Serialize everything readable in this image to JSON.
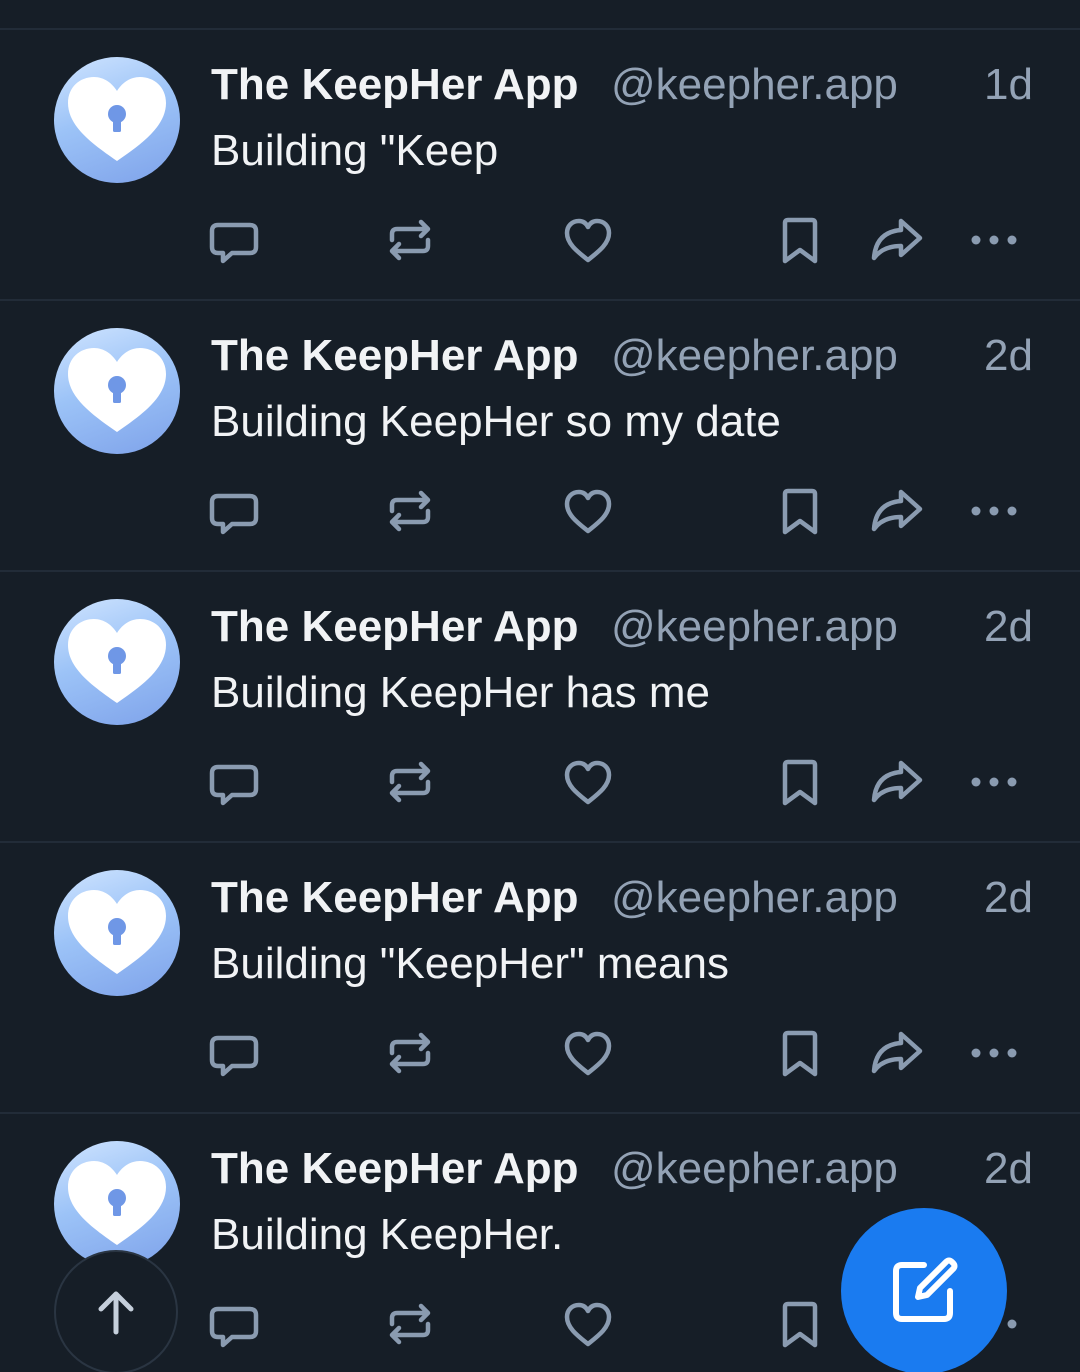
{
  "feed": {
    "posts": [
      {
        "display_name": "The KeepHer App",
        "handle": "@keepher.app",
        "time": "1d",
        "text": "Building \"Keep"
      },
      {
        "display_name": "The KeepHer App",
        "handle": "@keepher.app",
        "time": "2d",
        "text": "Building KeepHer so my date"
      },
      {
        "display_name": "The KeepHer App",
        "handle": "@keepher.app",
        "time": "2d",
        "text": "Building KeepHer has me"
      },
      {
        "display_name": "The KeepHer App",
        "handle": "@keepher.app",
        "time": "2d",
        "text": "Building \"KeepHer\" means"
      },
      {
        "display_name": "The KeepHer App",
        "handle": "@keepher.app",
        "time": "2d",
        "text": "Building KeepHer."
      }
    ],
    "actions": [
      "reply-icon",
      "repost-icon",
      "like-icon",
      "bookmark-icon",
      "share-icon",
      "more-icon"
    ]
  },
  "floating": {
    "scroll_top_icon": "arrow-up-icon",
    "compose_icon": "compose-icon"
  },
  "colors": {
    "background": "#161e27",
    "divider": "#222c38",
    "text_primary": "#f1f3f5",
    "text_secondary": "#93a2b5",
    "icon": "#8a9bb0",
    "accent": "#1a7bf0"
  }
}
